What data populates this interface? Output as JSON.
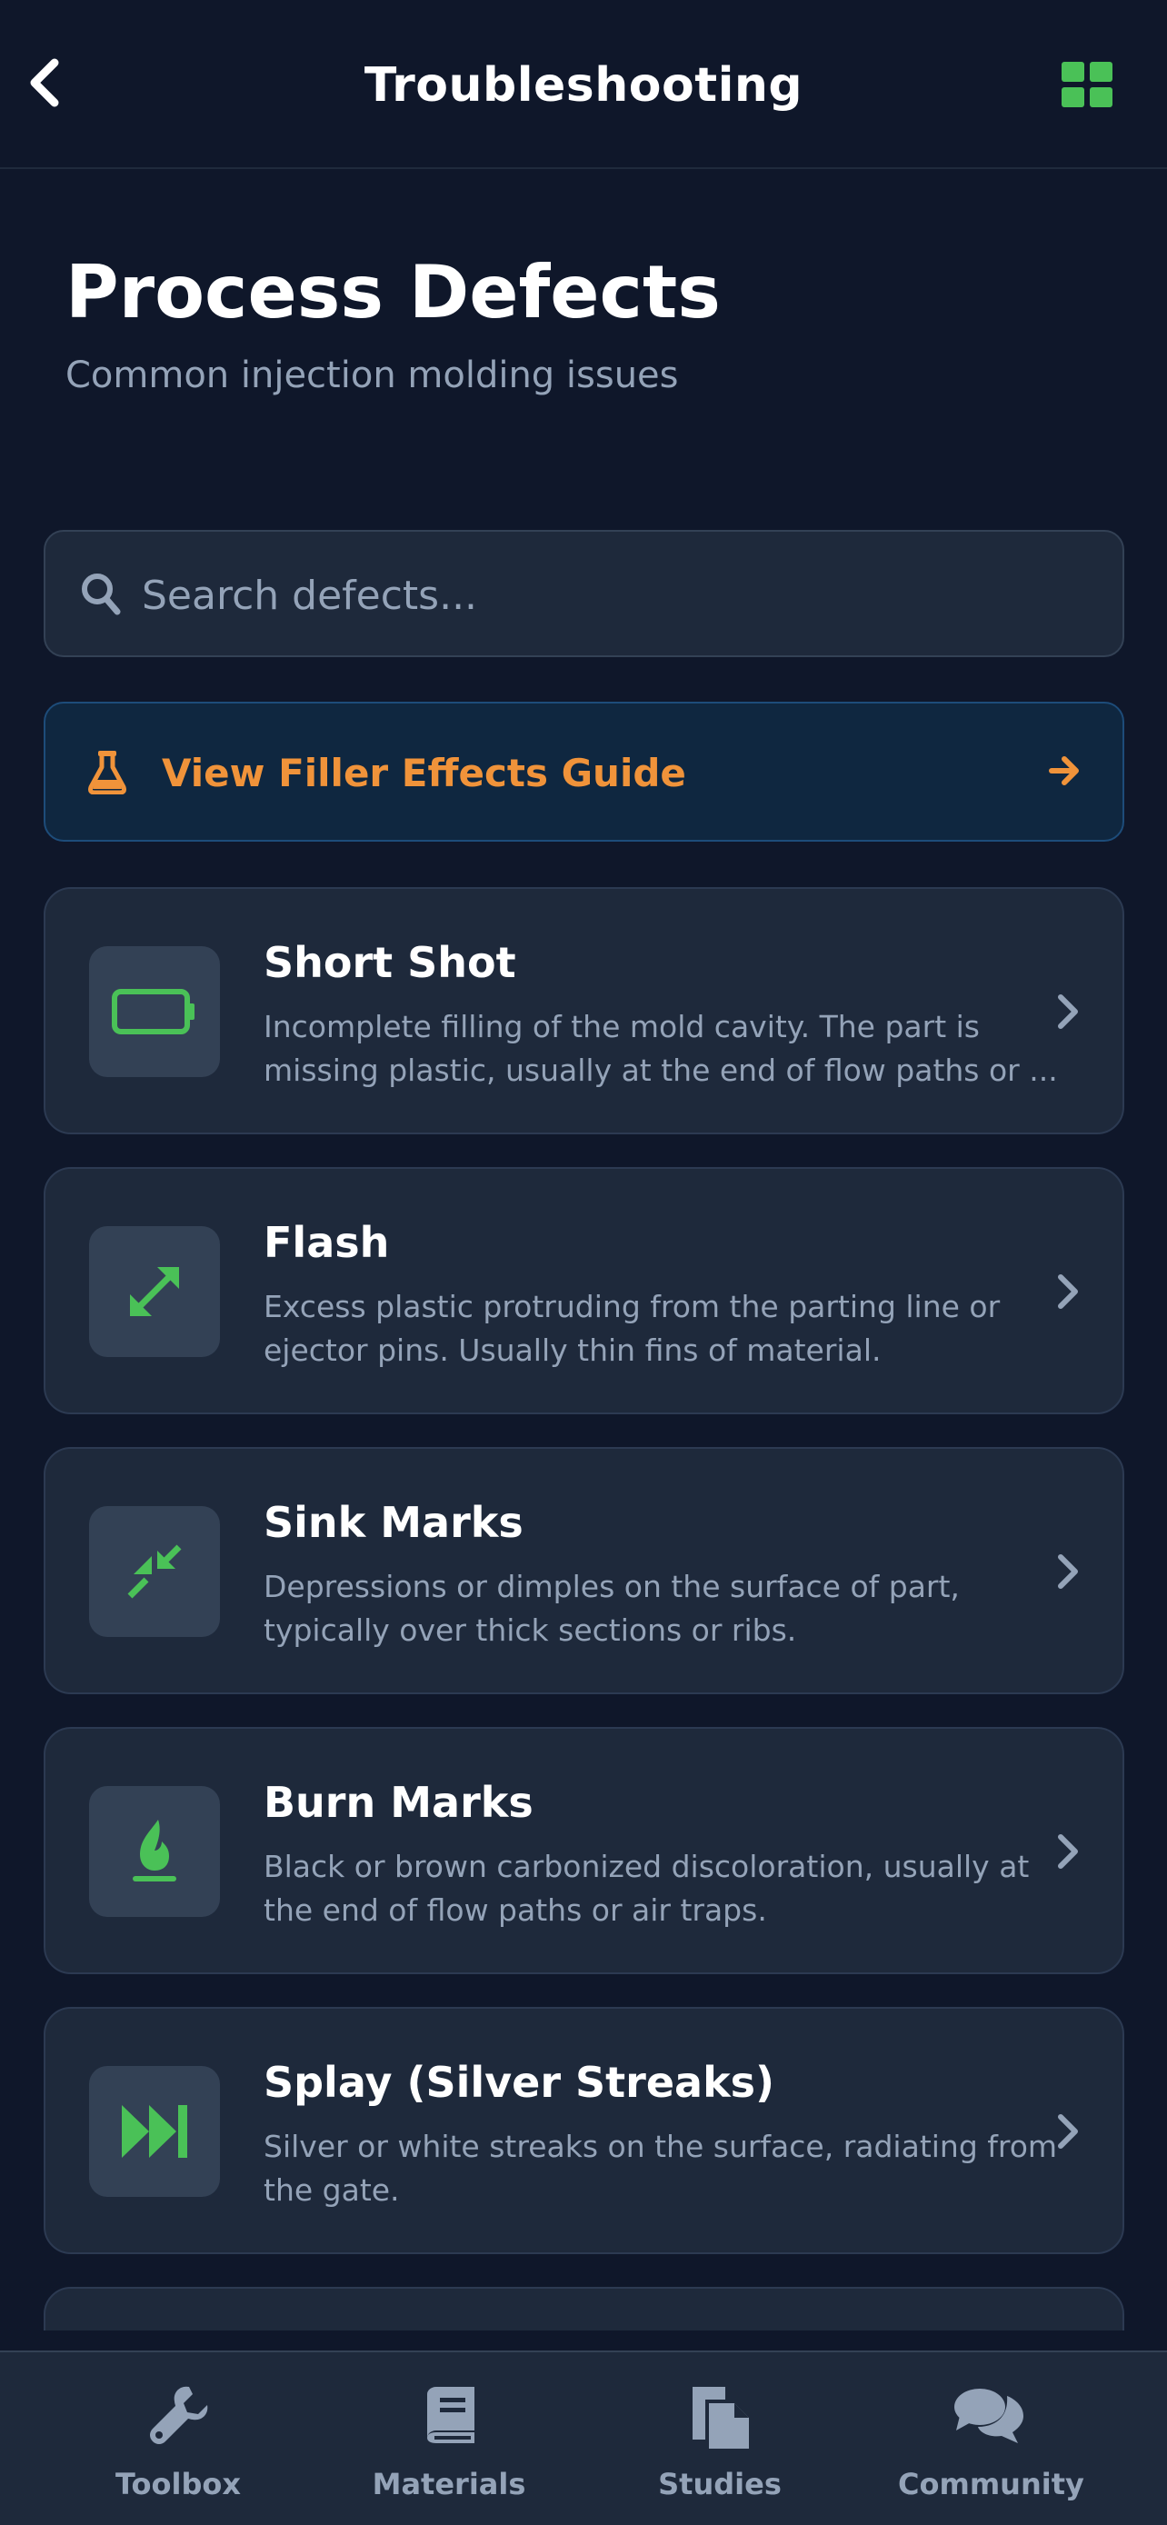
{
  "header": {
    "title": "Troubleshooting",
    "back_icon": "chevron-left-icon",
    "grid_icon": "grid-icon",
    "grid_color": "#4ac157"
  },
  "page": {
    "title": "Process Defects",
    "subtitle": "Common injection molding issues"
  },
  "search": {
    "placeholder": "Search defects...",
    "value": "",
    "icon": "search-icon"
  },
  "guide": {
    "label": "View Filler Effects Guide",
    "icon": "flask-icon",
    "color": "#f0933a"
  },
  "defects": [
    {
      "title": "Short Shot",
      "desc_line1": "Incomplete filling of the mold cavity. The part is",
      "desc_line2": "missing plastic, usually at the end of flow paths or ...",
      "icon": "battery-empty-icon"
    },
    {
      "title": "Flash",
      "desc_line1": "Excess plastic protruding from the parting line or",
      "desc_line2": "ejector pins. Usually thin fins of material.",
      "icon": "expand-arrows-icon"
    },
    {
      "title": "Sink Marks",
      "desc_line1": "Depressions or dimples on the surface of part,",
      "desc_line2": "typically over thick sections or ribs.",
      "icon": "compress-arrows-icon"
    },
    {
      "title": "Burn Marks",
      "desc_line1": "Black or brown carbonized discoloration, usually at",
      "desc_line2": "the end of flow paths or air traps.",
      "icon": "fire-icon"
    },
    {
      "title": "Splay (Silver Streaks)",
      "desc_line1": "Silver or white streaks on the surface, radiating from",
      "desc_line2": "the gate.",
      "icon": "fast-forward-icon"
    }
  ],
  "accent_color": "#4ac157",
  "nav": [
    {
      "label": "Toolbox",
      "icon": "wrench-icon"
    },
    {
      "label": "Materials",
      "icon": "book-icon"
    },
    {
      "label": "Studies",
      "icon": "file-copy-icon"
    },
    {
      "label": "Community",
      "icon": "comments-icon"
    }
  ]
}
